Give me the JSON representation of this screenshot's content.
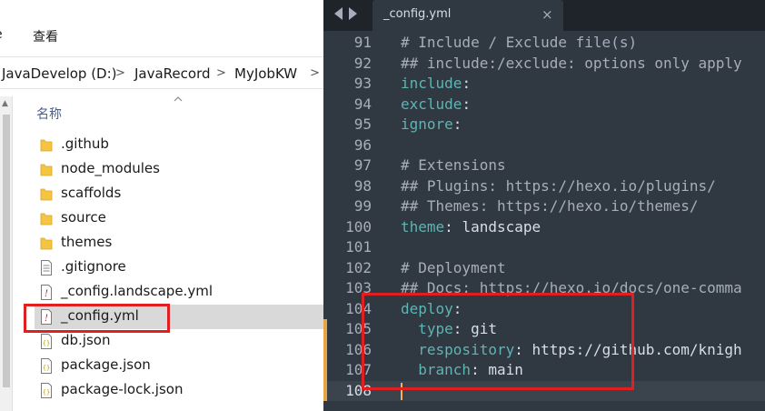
{
  "explorer": {
    "ribbon": {
      "tab_left": "e",
      "tab_view": "查看"
    },
    "breadcrumb": [
      {
        "label": "JavaDevelop (D:)"
      },
      {
        "label": "JavaRecord"
      },
      {
        "label": "MyJobKW"
      }
    ],
    "breadcrumb_separator": ">",
    "column_header": "名称",
    "files": [
      {
        "name": ".github",
        "icon": "folder-icon"
      },
      {
        "name": "node_modules",
        "icon": "folder-icon"
      },
      {
        "name": "scaffolds",
        "icon": "folder-icon"
      },
      {
        "name": "source",
        "icon": "folder-icon"
      },
      {
        "name": "themes",
        "icon": "folder-icon"
      },
      {
        "name": ".gitignore",
        "icon": "text-file-icon"
      },
      {
        "name": "_config.landscape.yml",
        "icon": "yaml-file-icon"
      },
      {
        "name": "_config.yml",
        "icon": "yaml-file-icon",
        "selected": true
      },
      {
        "name": "db.json",
        "icon": "json-file-icon"
      },
      {
        "name": "package.json",
        "icon": "json-file-icon"
      },
      {
        "name": "package-lock.json",
        "icon": "json-file-icon"
      }
    ]
  },
  "editor": {
    "tab_title": "_config.yml",
    "close_glyph": "×",
    "lines": [
      {
        "num": "91",
        "tokens": [
          {
            "t": "# Include / Exclude file(s)",
            "c": "comment"
          }
        ]
      },
      {
        "num": "92",
        "tokens": [
          {
            "t": "## include:/exclude: options only apply",
            "c": "comment"
          }
        ]
      },
      {
        "num": "93",
        "tokens": [
          {
            "t": "include",
            "c": "key"
          },
          {
            "t": ":",
            "c": "punct"
          }
        ]
      },
      {
        "num": "94",
        "tokens": [
          {
            "t": "exclude",
            "c": "key"
          },
          {
            "t": ":",
            "c": "punct"
          }
        ]
      },
      {
        "num": "95",
        "tokens": [
          {
            "t": "ignore",
            "c": "key"
          },
          {
            "t": ":",
            "c": "punct"
          }
        ]
      },
      {
        "num": "96",
        "tokens": []
      },
      {
        "num": "97",
        "tokens": [
          {
            "t": "# Extensions",
            "c": "comment"
          }
        ]
      },
      {
        "num": "98",
        "tokens": [
          {
            "t": "## Plugins: https://hexo.io/plugins/",
            "c": "comment"
          }
        ]
      },
      {
        "num": "99",
        "tokens": [
          {
            "t": "## Themes: https://hexo.io/themes/",
            "c": "comment"
          }
        ]
      },
      {
        "num": "100",
        "tokens": [
          {
            "t": "theme",
            "c": "key"
          },
          {
            "t": ": ",
            "c": "punct"
          },
          {
            "t": "landscape",
            "c": "value"
          }
        ]
      },
      {
        "num": "101",
        "tokens": []
      },
      {
        "num": "102",
        "tokens": [
          {
            "t": "# Deployment",
            "c": "comment"
          }
        ]
      },
      {
        "num": "103",
        "tokens": [
          {
            "t": "## Docs: https://hexo.io/docs/one-comma",
            "c": "comment"
          }
        ]
      },
      {
        "num": "104",
        "tokens": [
          {
            "t": "deploy",
            "c": "key"
          },
          {
            "t": ":",
            "c": "punct"
          }
        ]
      },
      {
        "num": "105",
        "modified": true,
        "tokens": [
          {
            "t": "  type",
            "c": "key"
          },
          {
            "t": ": ",
            "c": "punct"
          },
          {
            "t": "git",
            "c": "value"
          }
        ]
      },
      {
        "num": "106",
        "modified": true,
        "tokens": [
          {
            "t": "  respository",
            "c": "key"
          },
          {
            "t": ": ",
            "c": "punct"
          },
          {
            "t": "https://github.com/knigh",
            "c": "value"
          }
        ]
      },
      {
        "num": "107",
        "modified": true,
        "tokens": [
          {
            "t": "  branch",
            "c": "key"
          },
          {
            "t": ": ",
            "c": "punct"
          },
          {
            "t": "main",
            "c": "value"
          }
        ]
      },
      {
        "num": "108",
        "modified": true,
        "current": true,
        "tokens": []
      }
    ]
  },
  "colors": {
    "editor_bg": "#303841",
    "comment": "#a7adba",
    "key": "#5fb4b4",
    "annotation_red": "#e02020",
    "folder": "#f5c542"
  }
}
